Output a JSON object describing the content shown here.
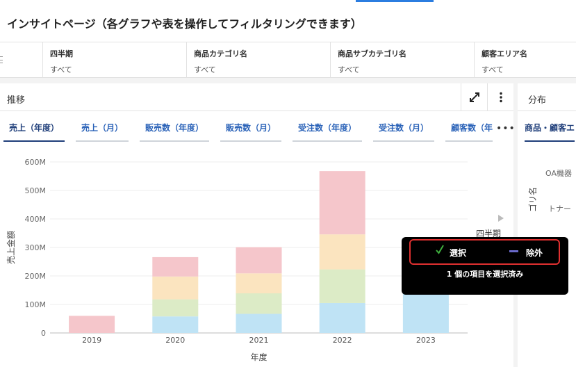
{
  "page": {
    "title": "インサイトページ（各グラフや表を操作してフィルタリングできます）"
  },
  "filters": [
    {
      "label": "四半期",
      "value": "すべて"
    },
    {
      "label": "商品カテゴリ名",
      "value": "すべて"
    },
    {
      "label": "商品サブカテゴリ名",
      "value": "すべて"
    },
    {
      "label": "顧客エリア名",
      "value": "すべて"
    }
  ],
  "trend_panel": {
    "title": "推移",
    "tabs": [
      "売上（年度）",
      "売上（月）",
      "販売数（年度）",
      "販売数（月）",
      "受注数（年度）",
      "受注数（月）",
      "顧客数（年"
    ],
    "active_tab": 0
  },
  "distribution_panel": {
    "title": "分布",
    "tab": "商品・顧客エ",
    "categories": [
      "OA機器",
      "トナー"
    ],
    "axis_label": "ゴリ名"
  },
  "legend": {
    "title": "四半期"
  },
  "tooltip": {
    "select_label": "選択",
    "exclude_label": "除外",
    "status": "1 個の項目を選択済み",
    "colors": {
      "check": "#3fb03f",
      "minus": "#6a6acb",
      "frame": "#e03030"
    }
  },
  "chart_data": {
    "type": "bar",
    "stacked": true,
    "categories": [
      "2019",
      "2020",
      "2021",
      "2022",
      "2023"
    ],
    "series": [
      {
        "values": [
          0,
          58,
          67,
          105,
          230
        ],
        "color": "#bfe3f5"
      },
      {
        "values": [
          0,
          60,
          72,
          118,
          0
        ],
        "color": "#dcebc6"
      },
      {
        "values": [
          0,
          80,
          70,
          123,
          0
        ],
        "color": "#fbe4bf"
      },
      {
        "values": [
          60,
          68,
          92,
          222,
          0
        ],
        "color": "#f5c6cb"
      }
    ],
    "highlight": {
      "category": "2023",
      "range": [
        235,
        322
      ],
      "color": "#8ec63f"
    },
    "y_ticks": [
      "0",
      "100M",
      "200M",
      "300M",
      "400M",
      "500M",
      "600M"
    ],
    "ylim": [
      0,
      600
    ],
    "xlabel": "年度",
    "ylabel": "売上金額",
    "grid": true
  }
}
